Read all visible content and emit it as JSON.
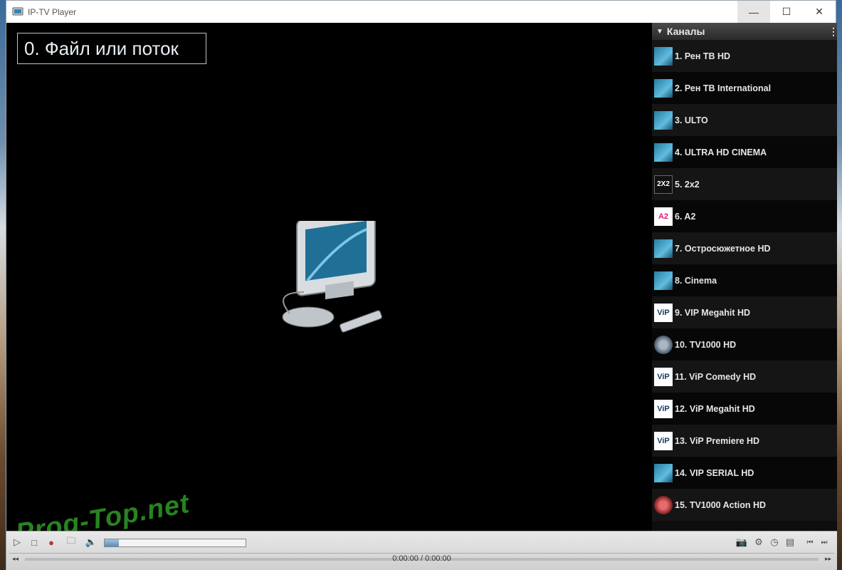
{
  "window": {
    "title": "IP-TV Player"
  },
  "titlebar": {
    "minimize_glyph": "—",
    "maximize_glyph": "☐",
    "close_glyph": "✕"
  },
  "video": {
    "source_label": "0. Файл или поток"
  },
  "watermark": "Prog-Top.net",
  "sidebar": {
    "header": "Каналы",
    "channels": [
      {
        "label": "1. Рен ТВ HD",
        "logo": "wave"
      },
      {
        "label": "2. Рен ТВ International",
        "logo": "wave"
      },
      {
        "label": "3. ULTO",
        "logo": "wave"
      },
      {
        "label": "4. ULTRA HD CINEMA",
        "logo": "wave"
      },
      {
        "label": "5. 2x2",
        "logo": "twobytwo",
        "logo_text": "2X2"
      },
      {
        "label": "6. A2",
        "logo": "a2",
        "logo_text": "A2"
      },
      {
        "label": "7. Остросюжетное HD",
        "logo": "wave"
      },
      {
        "label": "8. Cinema",
        "logo": "wave"
      },
      {
        "label": "9. VIP Megahit HD",
        "logo": "vip",
        "logo_text": "ViP"
      },
      {
        "label": "10. TV1000 HD",
        "logo": "tv1000"
      },
      {
        "label": "11. ViP Comedy HD",
        "logo": "vip",
        "logo_text": "ViP"
      },
      {
        "label": "12. ViP Megahit HD",
        "logo": "vip",
        "logo_text": "ViP"
      },
      {
        "label": "13. ViP Premiere HD",
        "logo": "vip",
        "logo_text": "ViP"
      },
      {
        "label": "14. VIP SERIAL HD",
        "logo": "wave"
      },
      {
        "label": "15. TV1000 Action HD",
        "logo": "tv1000a"
      }
    ]
  },
  "controls": {
    "time": "0:00:00 / 0:00:00",
    "volume": 0.1,
    "glyphs": {
      "play": "▷",
      "stop": "□",
      "record": "●",
      "open": "🗀",
      "volume": "🔈",
      "snapshot": "📷",
      "settings": "⚙",
      "timer": "◷",
      "playlist": "▤",
      "prev": "⏮",
      "next": "⏭",
      "seek_back": "◂◂",
      "seek_fwd": "▸▸"
    }
  }
}
